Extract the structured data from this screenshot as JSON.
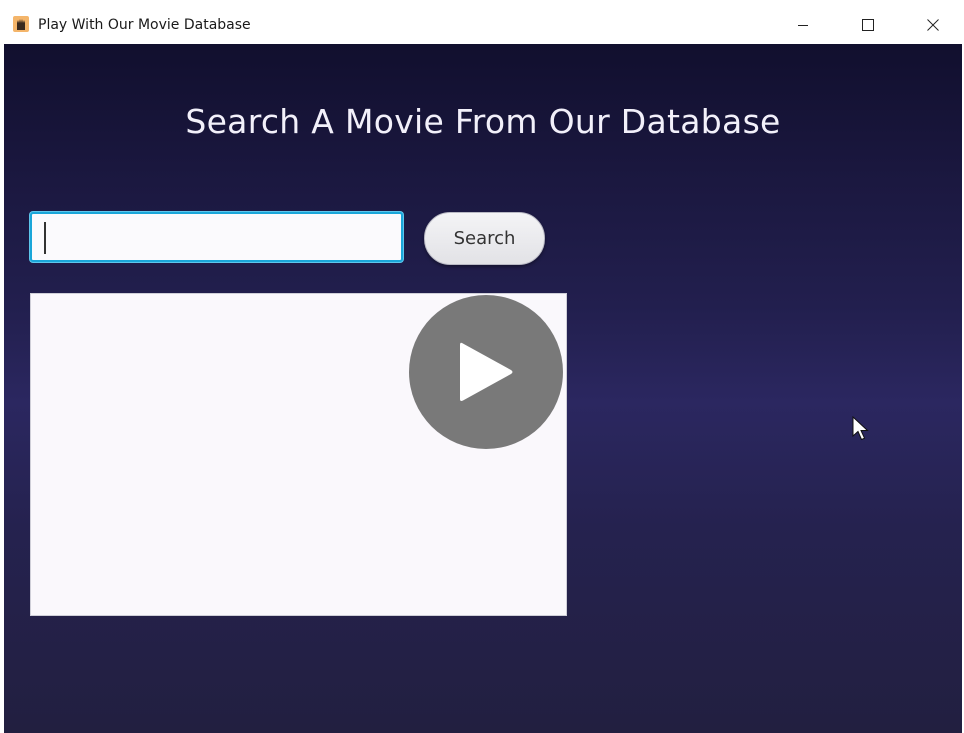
{
  "window": {
    "title": "Play With Our Movie Database",
    "controls": {
      "minimize_icon": "minimize-icon",
      "maximize_icon": "maximize-icon",
      "close_icon": "close-icon"
    }
  },
  "main": {
    "heading": "Search A Movie From Our Database",
    "search": {
      "value": "",
      "placeholder": ""
    },
    "search_button_label": "Search",
    "results": []
  },
  "overlay": {
    "play_icon": "play-icon"
  },
  "colors": {
    "background_top": "#110f2e",
    "background_mid": "#2b2760",
    "input_focus_border": "#1aa6d9",
    "heading_text": "#f2f0fa",
    "list_background": "#faf8fc"
  }
}
